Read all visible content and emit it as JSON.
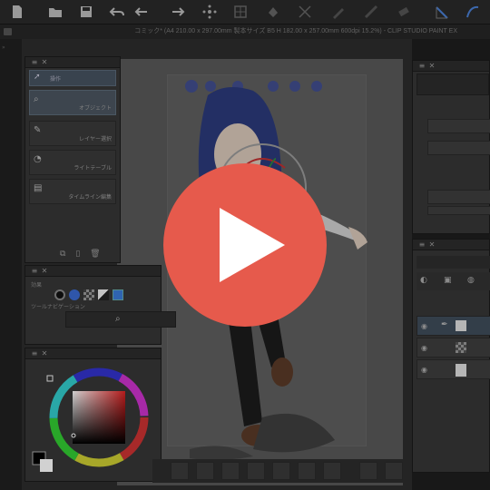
{
  "app": {
    "title": "コミック* (A4 210.00 x 297.00mm 製本サイズ B5 H 182.00 x 257.00mm 600dpi 15.2%) - CLIP STUDIO PAINT EX"
  },
  "toolbar": {
    "icons": [
      "new-file-icon",
      "open-file-icon",
      "save-icon",
      "undo-icon",
      "redo-icon",
      "transform-icon",
      "fill-icon",
      "eraser-icon",
      "line-icon"
    ]
  },
  "subtool": {
    "items": [
      {
        "label": "操作",
        "icon": "cursor-icon"
      },
      {
        "label": "オブジェクト",
        "icon": "object-icon"
      },
      {
        "label": "レイヤー選択",
        "icon": "layer-select-icon"
      },
      {
        "label": "ライトテーブル",
        "icon": "lighttable-icon"
      },
      {
        "label": "タイムライン編集",
        "icon": "timeline-icon"
      }
    ]
  },
  "toolprop": {
    "label_effect": "効果",
    "label_toolnav": "ツールナビゲーション"
  },
  "colors": {
    "accent_play": "#e65a4c",
    "panel_bg": "#363636",
    "selected_item": "#4b5560"
  }
}
